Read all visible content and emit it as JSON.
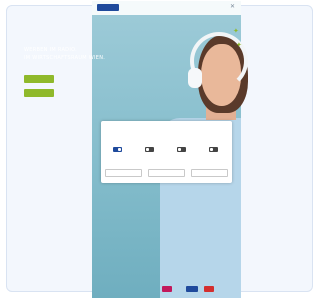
{
  "hero": {
    "headline_line1": "WERBEN IM RADIO.",
    "headline_line2": "IM WIRTSCHAFTSRAUM WIEN.",
    "button_primary": "",
    "button_secondary": ""
  },
  "cookie_modal": {
    "title": "",
    "text": "",
    "brand": "",
    "options": [
      {
        "label": "",
        "checked": true
      },
      {
        "label": "",
        "checked": false
      },
      {
        "label": "",
        "checked": false
      },
      {
        "label": "",
        "checked": false
      }
    ],
    "details_link": "",
    "buttons": [
      "",
      "",
      ""
    ]
  },
  "colors": {
    "accent_green": "#8fb92b",
    "brand_blue": "#1f4a9c",
    "hero_blue": "#86c0cf"
  },
  "icons": {
    "close": "close-icon",
    "sparkle": "sparkle-icon"
  }
}
